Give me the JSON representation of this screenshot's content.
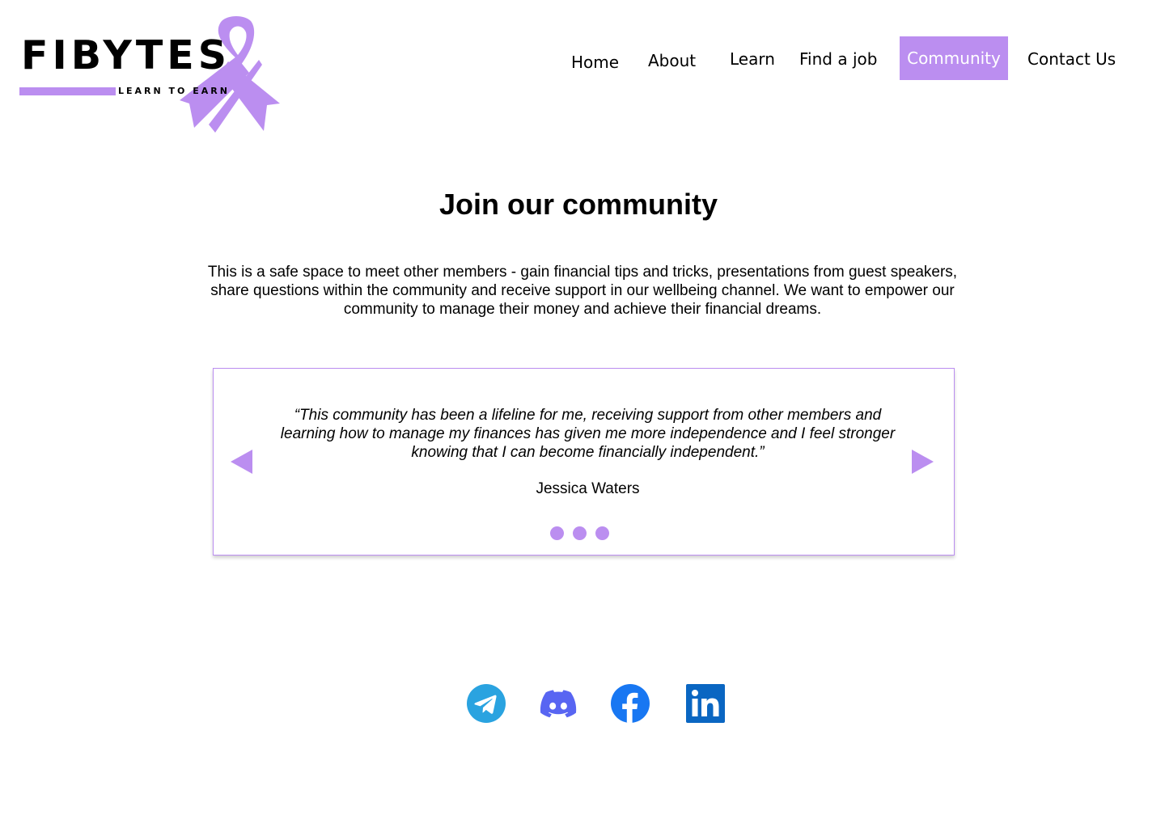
{
  "logo": {
    "wordmark": "FIBYTES",
    "tagline": "LEARN TO EARN",
    "accent_color": "#bb8ef0"
  },
  "nav": {
    "items": [
      {
        "label": "Home"
      },
      {
        "label": "About"
      },
      {
        "label": "Learn"
      },
      {
        "label": "Find a job"
      },
      {
        "label": "Community",
        "active": true
      },
      {
        "label": "Contact Us"
      }
    ]
  },
  "main": {
    "title": "Join our community",
    "intro": "This is a safe space to meet other members - gain financial tips and tricks, presentations from guest speakers, share questions within the community and receive support in our wellbeing channel. We want to empower our community to manage their money and achieve their financial dreams."
  },
  "testimonial": {
    "quote": "“This community has been a lifeline for me, receiving support from other members and learning how to manage my finances has given me more independence and I feel stronger knowing that I can become financially independent.”",
    "author": "Jessica Waters",
    "slide_count": 3,
    "prev_icon": "triangle-left-icon",
    "next_icon": "triangle-right-icon"
  },
  "social": [
    {
      "name": "telegram",
      "icon": "telegram-icon",
      "color": "#2aa3e0"
    },
    {
      "name": "discord",
      "icon": "discord-icon",
      "color": "#5865f2"
    },
    {
      "name": "facebook",
      "icon": "facebook-icon",
      "color": "#1877f2"
    },
    {
      "name": "linkedin",
      "icon": "linkedin-icon",
      "color": "#0a66c2"
    }
  ]
}
